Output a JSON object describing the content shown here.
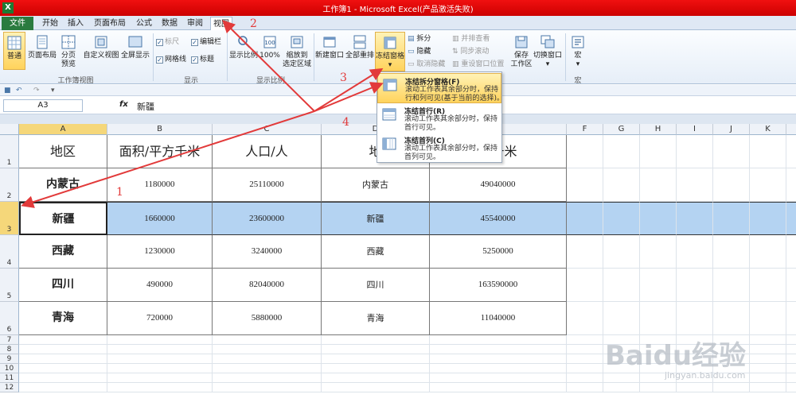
{
  "window": {
    "title": "工作簿1 - Microsoft Excel(产品激活失败)",
    "app_icon": "X"
  },
  "tabs": {
    "file": "文件",
    "items": [
      "开始",
      "插入",
      "页面布局",
      "公式",
      "数据",
      "审阅",
      "视图"
    ],
    "active": "视图"
  },
  "ribbon": {
    "views": {
      "normal": "普通",
      "page_layout": "页面布局",
      "page_break_1": "分页",
      "page_break_2": "预览",
      "custom": "自定义视图",
      "fullscreen": "全屏显示",
      "label": "工作簿视图"
    },
    "show": {
      "ruler": "标尺",
      "formula_bar": "编辑栏",
      "gridlines": "网格线",
      "headings": "标题",
      "label": "显示"
    },
    "zoom": {
      "zoom": "显示比例",
      "hundred": "100%",
      "selection_1": "缩放到",
      "selection_2": "选定区域",
      "label": "显示比例"
    },
    "window": {
      "new_window": "新建窗口",
      "arrange_all": "全部重排",
      "freeze": "冻结窗格",
      "freeze_arrow": "▾",
      "split": "拆分",
      "hide": "隐藏",
      "unhide": "取消隐藏",
      "side_by_side": "并排查看",
      "sync_scroll": "同步滚动",
      "reset_position": "重设窗口位置",
      "save_workspace_1": "保存",
      "save_workspace_2": "工作区",
      "switch_windows": "切换窗口",
      "switch_arrow": "▾"
    },
    "macros": {
      "macro": "宏",
      "macro_arrow": "▾",
      "label": "宏"
    }
  },
  "formula_bar": {
    "name_box": "A3",
    "fx": "fx",
    "value": "新疆"
  },
  "freeze_menu": [
    {
      "title": "冻结拆分窗格(F)",
      "desc1": "滚动工作表其余部分时，保持",
      "desc2": "行和列可见(基于当前的选择)。"
    },
    {
      "title": "冻结首行(R)",
      "desc1": "滚动工作表其余部分时，保持",
      "desc2": "首行可见。"
    },
    {
      "title": "冻结首列(C)",
      "desc1": "滚动工作表其余部分时，保持",
      "desc2": "首列可见。"
    }
  ],
  "columns": [
    "A",
    "B",
    "C",
    "D",
    "E",
    "F",
    "G",
    "H",
    "I",
    "J",
    "K",
    "L"
  ],
  "rows": [
    "1",
    "2",
    "3",
    "4",
    "5",
    "6",
    "7",
    "8",
    "9",
    "10",
    "11",
    "12"
  ],
  "table": {
    "headers": [
      "地区",
      "面积/平方千米",
      "人口/人",
      "地区",
      "面积/平方千米"
    ],
    "header_cells_shown": [
      "地区",
      "面积/平方千米",
      "人口/人",
      "地",
      "方千米"
    ],
    "data": [
      [
        "内蒙古",
        "1180000",
        "25110000",
        "内蒙古",
        "49040000"
      ],
      [
        "新疆",
        "1660000",
        "23600000",
        "新疆",
        "45540000"
      ],
      [
        "西藏",
        "1230000",
        "3240000",
        "西藏",
        "5250000"
      ],
      [
        "四川",
        "490000",
        "82040000",
        "四川",
        "163590000"
      ],
      [
        "青海",
        "720000",
        "5880000",
        "青海",
        "11040000"
      ]
    ]
  },
  "annotations": [
    "1",
    "2",
    "3",
    "4"
  ],
  "watermark": {
    "text": "Baidu经验",
    "sub": "jingyan.baidu.com"
  },
  "colors": {
    "title_bar": "#e00000",
    "file_tab": "#2a7b3f",
    "selected_row": "#b4d3f2",
    "annotation": "#e23a3a"
  }
}
